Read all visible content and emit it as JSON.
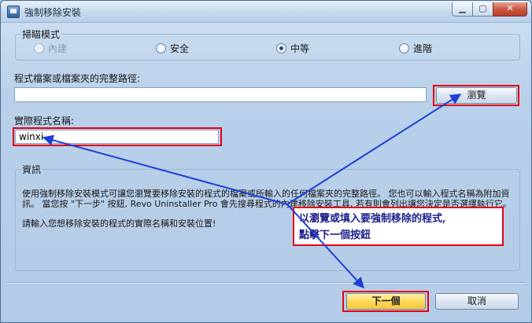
{
  "window": {
    "title": "強制移除安裝"
  },
  "scan_mode": {
    "legend": "掃瞄模式",
    "options": [
      {
        "label": "內建",
        "checked": false,
        "disabled": true
      },
      {
        "label": "安全",
        "checked": false,
        "disabled": false
      },
      {
        "label": "中等",
        "checked": true,
        "disabled": false
      },
      {
        "label": "進階",
        "checked": false,
        "disabled": false
      }
    ]
  },
  "path": {
    "label": "程式檔案或檔案夾的完整路徑:",
    "value": "",
    "browse_label": "瀏覽"
  },
  "program_name": {
    "label": "實際程式名稱:",
    "value": "winxi"
  },
  "info": {
    "legend": "資訊",
    "paragraph1": "使用強制移除安裝模式可讓您瀏覽要移除安裝的程式的檔案或所輸入的任何檔案夾的完整路徑。 您也可以輸入程式名稱為附加資訊。 當您按 \"下一步\" 按鈕, Revo Uninstaller Pro 會先搜尋程式的內建移除安裝工具, 若有則會列出讓您決定是否選擇執行它。",
    "paragraph2": "請輸入您想移除安裝的程式的實際名稱和安裝位置!"
  },
  "annotation": {
    "line1": "以瀏覽或填入要強制移除的程式,",
    "line2": "點擊下一個按鈕"
  },
  "footer": {
    "next_label": "下一個",
    "cancel_label": "取消"
  },
  "colors": {
    "highlight": "#e60012",
    "annotation_text": "#1d1d8c",
    "arrow": "#1f3fd6"
  }
}
